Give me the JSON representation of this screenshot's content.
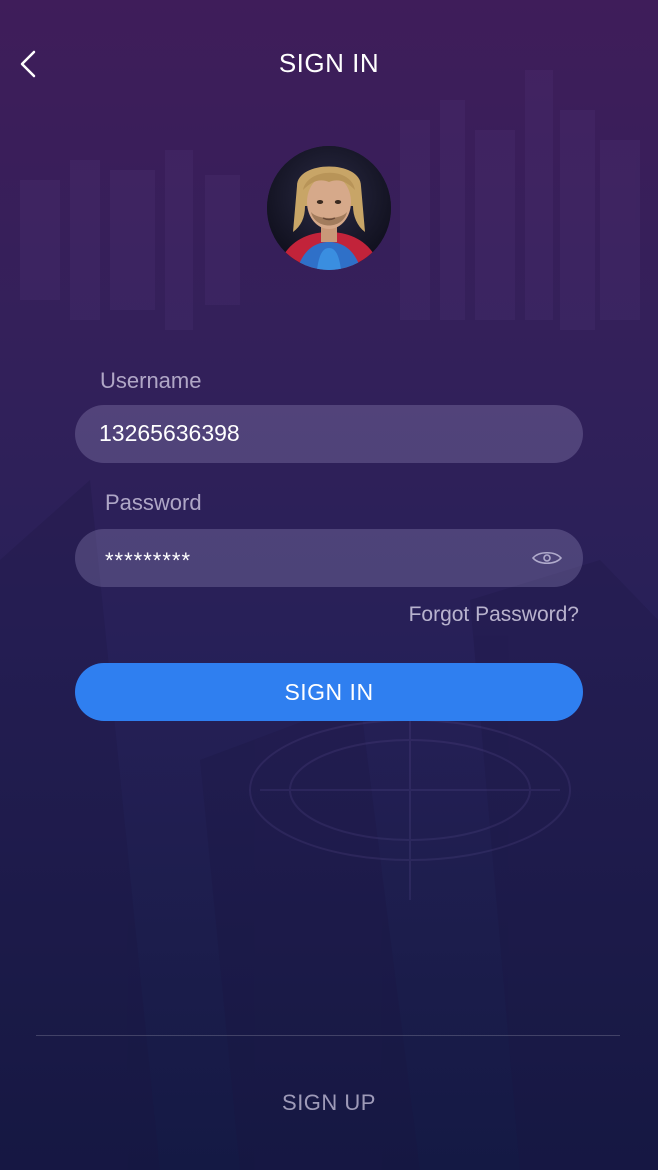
{
  "header": {
    "title": "SIGN IN",
    "back_icon": "chevron-left-icon"
  },
  "avatar": {
    "alt": "User avatar photo"
  },
  "form": {
    "username": {
      "label": "Username",
      "value": "13265636398"
    },
    "password": {
      "label": "Password",
      "value": "*********",
      "toggle_icon": "eye-icon"
    },
    "forgot_password": "Forgot Password?",
    "submit_label": "SIGN IN"
  },
  "footer": {
    "signup_label": "SIGN UP"
  },
  "colors": {
    "primary_button": "#2f7ff0",
    "bg_top": "#3f1d5a",
    "bg_bottom": "#141944",
    "field_bg": "rgba(200,190,235,0.22)"
  }
}
